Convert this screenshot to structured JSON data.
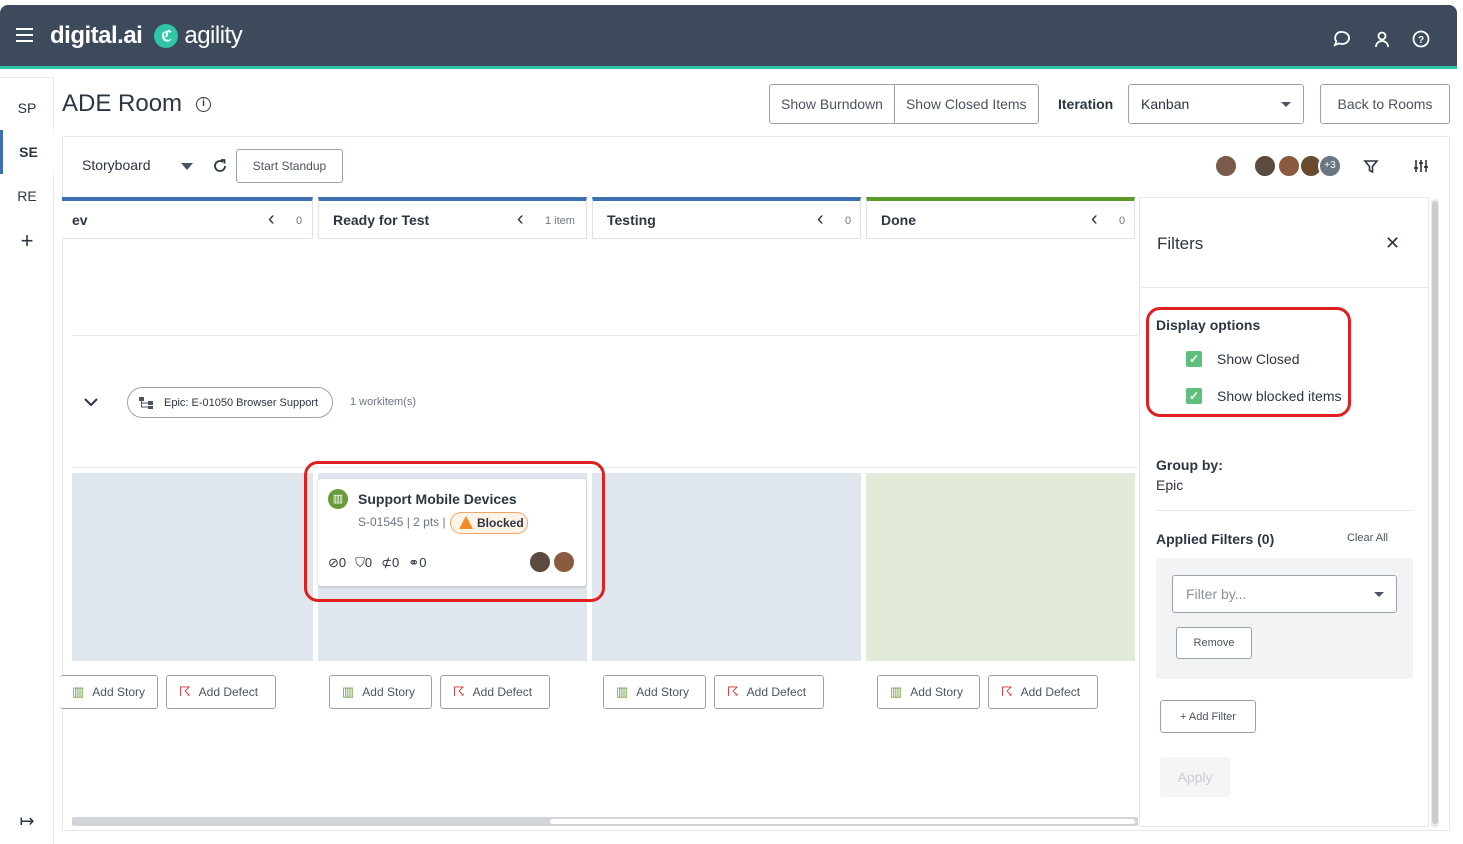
{
  "app": {
    "brand_left": "digital.ai",
    "brand_right": "agility"
  },
  "sidebar": {
    "items": [
      {
        "label": "SP"
      },
      {
        "label": "SE"
      },
      {
        "label": "RE"
      },
      {
        "label": "+"
      }
    ],
    "collapse_icon": "↦"
  },
  "header": {
    "title": "ADE Room",
    "show_burndown": "Show Burndown",
    "show_closed_items": "Show Closed Items",
    "iteration_label": "Iteration",
    "iteration_value": "Kanban",
    "back_to_rooms": "Back to Rooms"
  },
  "toolbar": {
    "view_select": "Storyboard",
    "start_standup": "Start Standup",
    "avatars_more": "+3"
  },
  "columns": [
    {
      "name": "ev",
      "count": "0"
    },
    {
      "name": "Ready for Test",
      "count": "1 item"
    },
    {
      "name": "Testing",
      "count": "0"
    },
    {
      "name": "Done",
      "count": "0"
    }
  ],
  "group": {
    "epic_label": "Epic: E-01050 Browser Support",
    "count_text": "1 workitem(s)"
  },
  "card": {
    "title": "Support Mobile Devices",
    "meta": "S-01545 | 2 pts |",
    "status": "Blocked",
    "tasks": "0",
    "tests": "0",
    "attachments": "0",
    "links": "0"
  },
  "add_buttons": {
    "story": "Add Story",
    "defect": "Add Defect"
  },
  "filters": {
    "title": "Filters",
    "display_options": "Display options",
    "show_closed": "Show Closed",
    "show_blocked": "Show blocked items",
    "group_by_label": "Group by:",
    "group_by_value": "Epic",
    "applied_filters": "Applied Filters (0)",
    "clear_all": "Clear All",
    "filter_placeholder": "Filter by...",
    "remove": "Remove",
    "add_filter": "+ Add Filter",
    "apply": "Apply"
  },
  "colors": {
    "topbar": "#3c4a5c",
    "accent": "#2fc6a6",
    "column_blue": "#3d6fb0",
    "column_done": "#5a9a2a",
    "highlight": "#e02020"
  }
}
